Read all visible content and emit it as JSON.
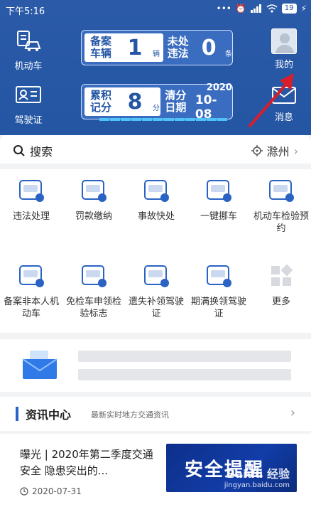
{
  "status_bar": {
    "time": "下午5:16",
    "battery": "19"
  },
  "header": {
    "motor_vehicle_label": "机动车",
    "license_label": "驾驶证",
    "vehicles_card": {
      "label1": "备案车辆",
      "value1": "1",
      "unit1": "辆",
      "label2": "未处违法",
      "value2": "0",
      "unit2": "条"
    },
    "points_card": {
      "label1": "累积记分",
      "value1": "8",
      "unit1": "分",
      "label2": "清分日期",
      "year": "2020",
      "date": "10-08"
    },
    "mine_label": "我的",
    "message_label": "消息"
  },
  "search": {
    "label": "搜索",
    "city": "滁州"
  },
  "services": [
    {
      "label": "违法处理",
      "icon": "car-violation-icon"
    },
    {
      "label": "罚款缴纳",
      "icon": "fine-payment-icon"
    },
    {
      "label": "事故快处",
      "icon": "accident-icon"
    },
    {
      "label": "一键挪车",
      "icon": "move-car-icon"
    },
    {
      "label": "机动车检验预约",
      "icon": "inspection-appointment-icon"
    },
    {
      "label": "备案非本人机动车",
      "icon": "register-vehicle-icon"
    },
    {
      "label": "免检车申领检验标志",
      "icon": "exempt-label-icon"
    },
    {
      "label": "遗失补领驾驶证",
      "icon": "reissue-license-icon"
    },
    {
      "label": "期满换领驾驶证",
      "icon": "renew-license-icon"
    },
    {
      "label": "更多",
      "icon": "more-icon"
    }
  ],
  "news": {
    "title": "资讯中心",
    "subtitle": "最新实时地方交通资讯"
  },
  "article": {
    "title": "曝光 | 2020年第二季度交通安全 隐患突出的...",
    "date": "2020-07-31",
    "image_text": "安全提醒"
  },
  "watermark": {
    "brand": "Baidu 经验",
    "url": "jingyan.baidu.com"
  },
  "colors": {
    "header_blue": "#2456a4",
    "accent": "#2a63c4",
    "arrow_red": "#d81e2b"
  }
}
